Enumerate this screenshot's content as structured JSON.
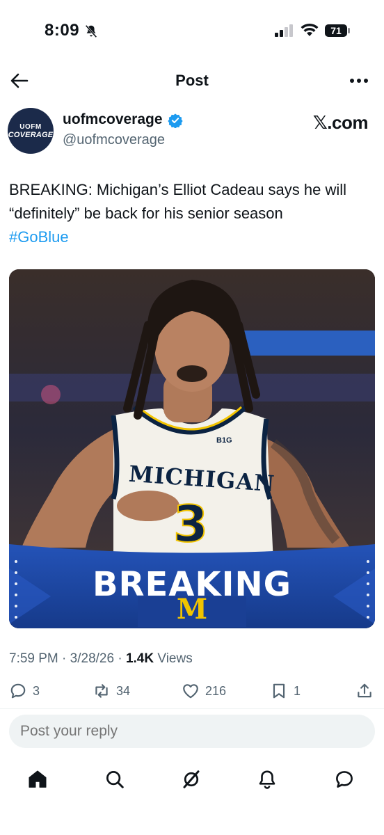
{
  "status_bar": {
    "time": "8:09",
    "battery_level": "71",
    "icons": [
      "bell-slash-icon",
      "cellular-signal-icon",
      "wifi-icon",
      "battery-icon"
    ]
  },
  "header": {
    "title": "Post",
    "back_icon": "arrow-left-icon",
    "more_icon": "more-horizontal-icon"
  },
  "author": {
    "avatar_line1": "UOFM",
    "avatar_line2": "COVERAGE",
    "display_name": "uofmcoverage",
    "handle": "@uofmcoverage",
    "verified": true,
    "source_badge": "𝕏.com"
  },
  "post": {
    "text": "BREAKING: Michigan’s Elliot Cadeau says he will “definitely” be back for his senior season",
    "hashtag": "#GoBlue"
  },
  "media": {
    "overlay_title": "BREAKING",
    "overlay_logo": "M",
    "jersey_school": "MICHIGAN",
    "jersey_number": "3",
    "jersey_conference": "B1G",
    "colors": {
      "navy": "#0b2342",
      "maize": "#f2c400",
      "banner_blue": "#1e4aa8"
    }
  },
  "meta": {
    "time": "7:59 PM",
    "date": "3/28/26",
    "views_count": "1.4K",
    "views_label": "Views"
  },
  "actions": {
    "replies": "3",
    "reposts": "34",
    "likes": "216",
    "bookmarks": "1"
  },
  "reply": {
    "placeholder": "Post your reply"
  },
  "tab_bar": {
    "items": [
      "home-icon",
      "search-icon",
      "grok-icon",
      "notifications-icon",
      "messages-icon"
    ]
  },
  "colors": {
    "accent": "#1d9bf0",
    "text_primary": "#0f1419",
    "text_secondary": "#536471",
    "reply_bg": "#eff3f4"
  }
}
